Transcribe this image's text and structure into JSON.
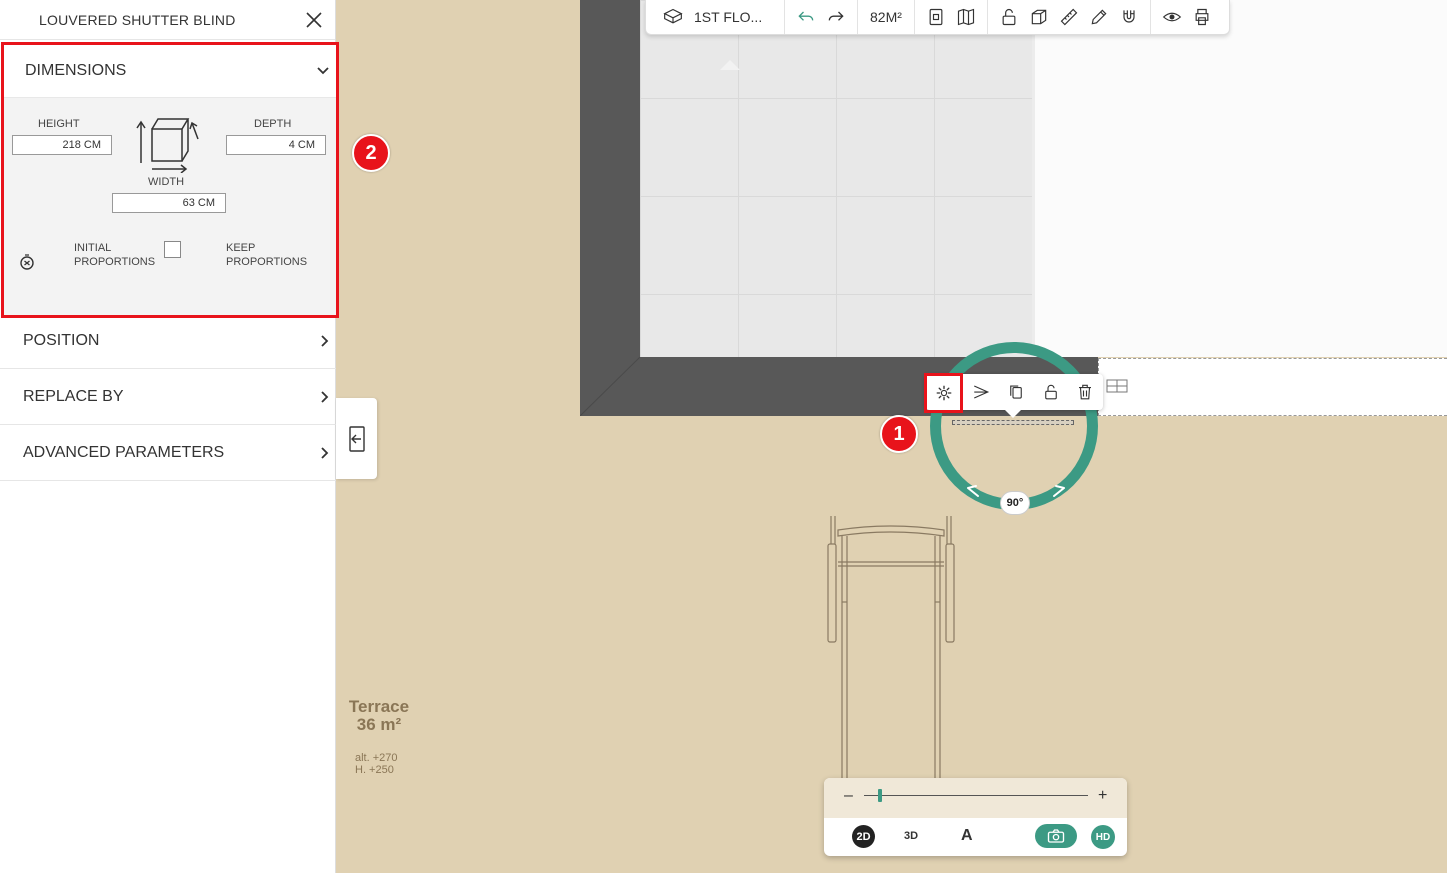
{
  "panel": {
    "title": "LOUVERED SHUTTER BLIND",
    "dimensions": {
      "header": "DIMENSIONS",
      "height_label": "HEIGHT",
      "height_value": "218  CM",
      "depth_label": "DEPTH",
      "depth_value": "4  CM",
      "width_label": "WIDTH",
      "width_value": "63  CM",
      "initial_proportions": "INITIAL\nPROPORTIONS",
      "keep_proportions": "KEEP\nPROPORTIONS"
    },
    "sections": [
      {
        "label": "POSITION"
      },
      {
        "label": "REPLACE BY"
      },
      {
        "label": "ADVANCED PARAMETERS"
      }
    ]
  },
  "toolbar": {
    "floor_label": "1ST FLO...",
    "area_label": "82M²"
  },
  "canvas": {
    "room_name": "Terrace",
    "room_area": "36 m²",
    "room_alt": "alt. +270",
    "room_height": "H.  +250",
    "rotation_angle": "90°"
  },
  "view": {
    "mode_2d": "2D",
    "mode_3d": "3D",
    "annotation": "A",
    "hd": "HD",
    "zoom_minus": "–",
    "zoom_plus": "+",
    "zoom_level": 0.07
  },
  "badges": {
    "step1": "1",
    "step2": "2"
  },
  "colors": {
    "accent": "#3c9a84",
    "highlight": "#e8131b",
    "terrace": "#e0d1b2",
    "wall": "#585858"
  }
}
